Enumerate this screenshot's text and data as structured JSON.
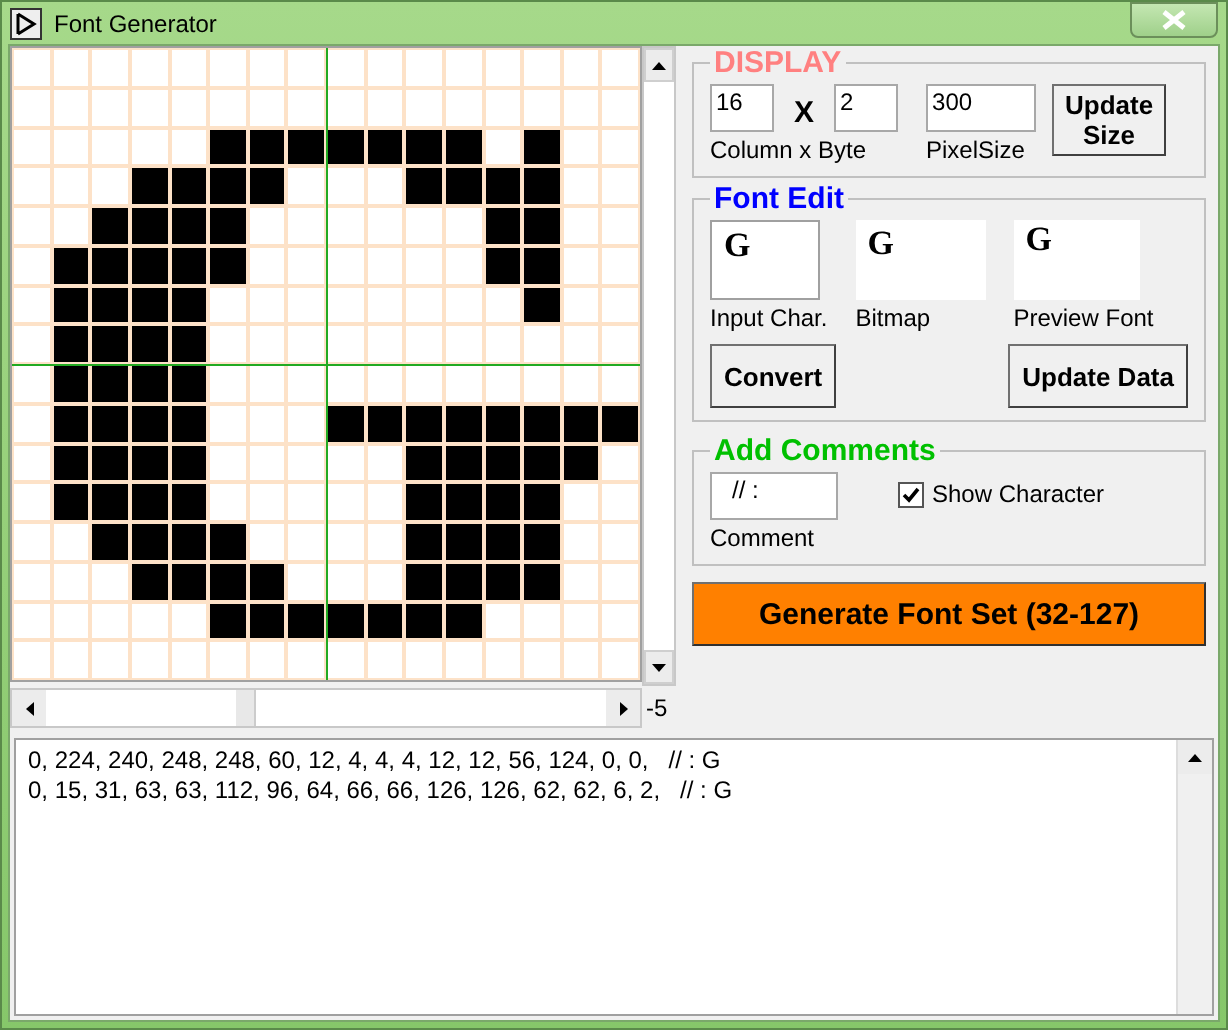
{
  "window": {
    "title": "Font Generator"
  },
  "editor": {
    "pixels": [
      [
        false,
        false,
        false,
        false,
        false,
        false,
        false,
        false,
        false,
        false,
        false,
        false,
        false,
        false,
        false,
        false
      ],
      [
        false,
        false,
        false,
        false,
        false,
        false,
        false,
        false,
        false,
        false,
        false,
        false,
        false,
        false,
        false,
        false
      ],
      [
        false,
        false,
        false,
        false,
        false,
        true,
        true,
        true,
        true,
        true,
        true,
        true,
        false,
        true,
        false,
        false
      ],
      [
        false,
        false,
        false,
        true,
        true,
        true,
        true,
        false,
        false,
        false,
        true,
        true,
        true,
        true,
        false,
        false
      ],
      [
        false,
        false,
        true,
        true,
        true,
        true,
        false,
        false,
        false,
        false,
        false,
        false,
        true,
        true,
        false,
        false
      ],
      [
        false,
        true,
        true,
        true,
        true,
        true,
        false,
        false,
        false,
        false,
        false,
        false,
        true,
        true,
        false,
        false
      ],
      [
        false,
        true,
        true,
        true,
        true,
        false,
        false,
        false,
        false,
        false,
        false,
        false,
        false,
        true,
        false,
        false
      ],
      [
        false,
        true,
        true,
        true,
        true,
        false,
        false,
        false,
        false,
        false,
        false,
        false,
        false,
        false,
        false,
        false
      ],
      [
        false,
        true,
        true,
        true,
        true,
        false,
        false,
        false,
        false,
        false,
        false,
        false,
        false,
        false,
        false,
        false
      ],
      [
        false,
        true,
        true,
        true,
        true,
        false,
        false,
        false,
        true,
        true,
        true,
        true,
        true,
        true,
        true,
        true
      ],
      [
        false,
        true,
        true,
        true,
        true,
        false,
        false,
        false,
        false,
        false,
        true,
        true,
        true,
        true,
        true,
        false
      ],
      [
        false,
        true,
        true,
        true,
        true,
        false,
        false,
        false,
        false,
        false,
        true,
        true,
        true,
        true,
        false,
        false
      ],
      [
        false,
        false,
        true,
        true,
        true,
        true,
        false,
        false,
        false,
        false,
        true,
        true,
        true,
        true,
        false,
        false
      ],
      [
        false,
        false,
        false,
        true,
        true,
        true,
        true,
        false,
        false,
        false,
        true,
        true,
        true,
        true,
        false,
        false
      ],
      [
        false,
        false,
        false,
        false,
        false,
        true,
        true,
        true,
        true,
        true,
        true,
        true,
        false,
        false,
        false,
        false
      ],
      [
        false,
        false,
        false,
        false,
        false,
        false,
        false,
        false,
        false,
        false,
        false,
        false,
        false,
        false,
        false,
        false
      ]
    ],
    "scroll_value": "-5"
  },
  "display": {
    "title": "DISPLAY",
    "columns": "16",
    "separator": "X",
    "bytes": "2",
    "columns_label": "Column x Byte",
    "pixel_size": "300",
    "pixel_size_label": "PixelSize",
    "update_button": "Update Size"
  },
  "font_edit": {
    "title": "Font Edit",
    "input_char": "G",
    "input_label": "Input Char.",
    "bitmap": "G",
    "bitmap_label": "Bitmap",
    "preview": "G",
    "preview_label": "Preview Font",
    "convert_button": "Convert",
    "update_data_button": "Update Data"
  },
  "comments": {
    "title": "Add Comments",
    "comment": "// :",
    "comment_label": "Comment",
    "show_character": {
      "label": "Show Character",
      "checked": true
    }
  },
  "generate_button": "Generate Font Set (32-127)",
  "output": {
    "lines": [
      "0, 224, 240, 248, 248, 60, 12, 4, 4, 4, 12, 12, 56, 124, 0, 0,   // : G",
      "0, 15, 31, 63, 63, 112, 96, 64, 66, 66, 126, 126, 62, 62, 6, 2,   // : G"
    ]
  }
}
